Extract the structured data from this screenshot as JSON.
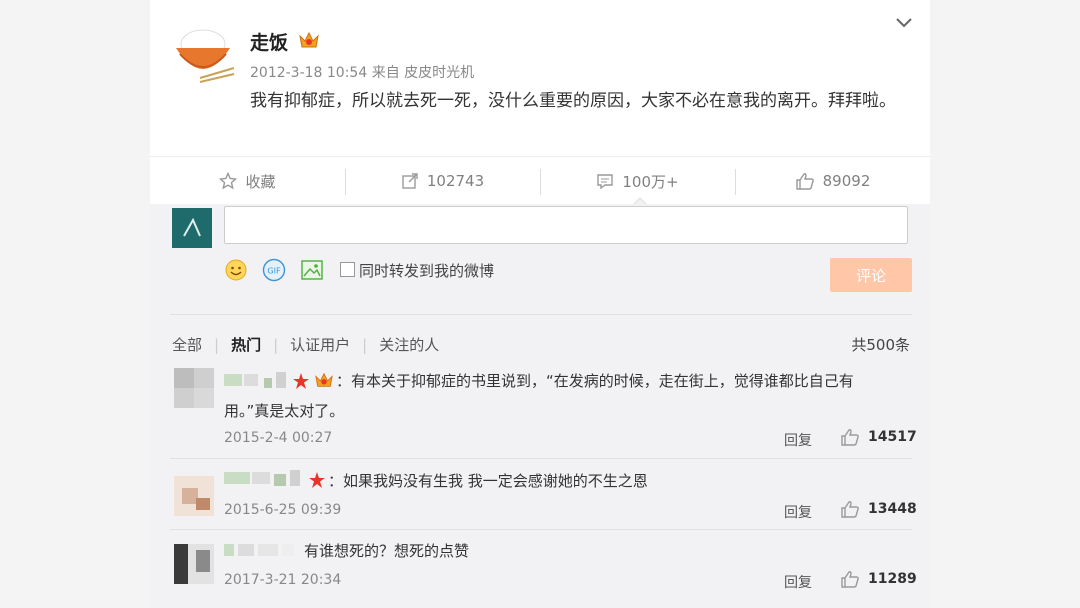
{
  "post": {
    "author": "走饭",
    "timestamp": "2012-3-18 10:54",
    "source_prefix": "来自",
    "source": "皮皮时光机",
    "text": "我有抑郁症，所以就去死一死，没什么重要的原因，大家不必在意我的离开。拜拜啦。"
  },
  "actions": {
    "favorite_label": "收藏",
    "repost_count": "102743",
    "comment_count": "100万+",
    "like_count": "89092"
  },
  "composer": {
    "forward_label": "同时转发到我的微博",
    "submit_label": "评论"
  },
  "filters": {
    "tabs": [
      "全部",
      "热门",
      "认证用户",
      "关注的人"
    ],
    "active": "热门",
    "total": "共500条"
  },
  "comments": [
    {
      "text": "：有本关于抑郁症的书里说到，“在发病的时候，走在街上，觉得谁都比自己有用。”真是太对了。",
      "time": "2015-2-4 00:27",
      "reply": "回复",
      "likes": "14517"
    },
    {
      "text": "：如果我妈没有生我 我一定会感谢她的不生之恩",
      "time": "2015-6-25 09:39",
      "reply": "回复",
      "likes": "13448"
    },
    {
      "text": "有谁想死的？想死的点赞",
      "time": "2017-3-21 20:34",
      "reply": "回复",
      "likes": "11289"
    }
  ],
  "colors": {
    "submit_disabled": "#ffc7a8",
    "avatar_teal": "#1f6b6c",
    "muted_text": "#888888"
  }
}
